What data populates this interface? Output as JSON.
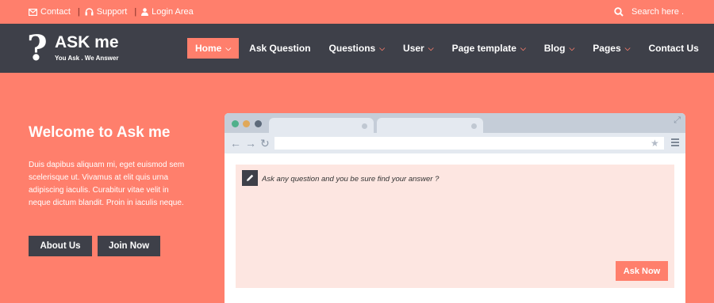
{
  "topbar": {
    "links": [
      {
        "label": "Contact",
        "icon": "envelope-icon"
      },
      {
        "label": "Support",
        "icon": "headphones-icon"
      },
      {
        "label": "Login Area",
        "icon": "user-icon"
      }
    ],
    "search_placeholder": "Search here ..."
  },
  "brand": {
    "name": "ASK me",
    "tagline": "You Ask . We Answer"
  },
  "nav": {
    "items": [
      {
        "label": "Home",
        "active": true,
        "has_dropdown": true
      },
      {
        "label": "Ask Question",
        "active": false,
        "has_dropdown": false
      },
      {
        "label": "Questions",
        "active": false,
        "has_dropdown": true
      },
      {
        "label": "User",
        "active": false,
        "has_dropdown": true
      },
      {
        "label": "Page template",
        "active": false,
        "has_dropdown": true
      },
      {
        "label": "Blog",
        "active": false,
        "has_dropdown": true
      },
      {
        "label": "Pages",
        "active": false,
        "has_dropdown": true
      },
      {
        "label": "Contact Us",
        "active": false,
        "has_dropdown": false
      }
    ]
  },
  "hero": {
    "title": "Welcome to Ask me",
    "text": "Duis dapibus aliquam mi, eget euismod sem scelerisque ut. Vivamus at elit quis urna adipiscing iaculis. Curabitur vitae velit in neque dictum blandit. Proin in iaculis neque.",
    "buttons": {
      "about": "About Us",
      "join": "Join Now"
    }
  },
  "ask_widget": {
    "placeholder": "Ask any question and you be sure find your answer ?",
    "submit_label": "Ask Now"
  },
  "colors": {
    "accent": "#ff7f6c",
    "dark": "#3e4049",
    "ask_box_bg": "#fde6e1",
    "browser_chrome": "#c5cdd8"
  }
}
